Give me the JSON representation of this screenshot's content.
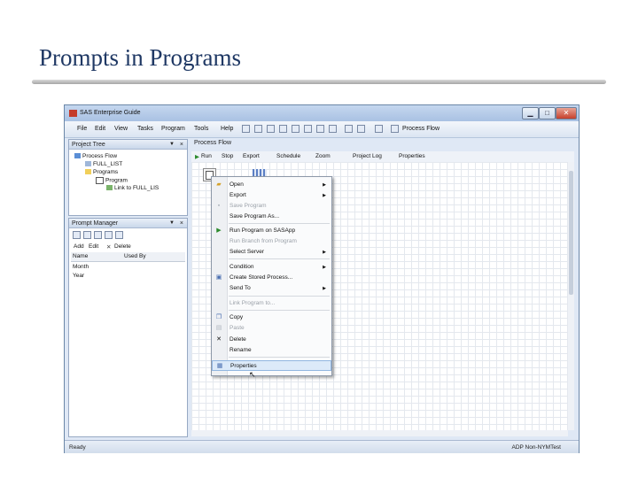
{
  "slide": {
    "title": "Prompts in Programs"
  },
  "window": {
    "title": "SAS Enterprise Guide",
    "controls": {
      "minimize": "▁",
      "maximize": "□",
      "close": "✕"
    }
  },
  "menubar": {
    "items": [
      "File",
      "Edit",
      "View",
      "Tasks",
      "Program",
      "Tools",
      "Help"
    ],
    "process_flow_label": "Process Flow"
  },
  "project_tree": {
    "title": "Project Tree",
    "nodes": [
      "Process Flow",
      "FULL_LIST",
      "Programs",
      "Program",
      "Link to FULL_LIS"
    ]
  },
  "prompt_manager": {
    "title": "Prompt Manager",
    "actions": {
      "add": "Add",
      "edit": "Edit",
      "delete": "Delete"
    },
    "columns": [
      "Name",
      "Used By"
    ],
    "rows": [
      "Month",
      "Year"
    ]
  },
  "workspace": {
    "tab_label": "Process Flow",
    "toolbar": [
      "Run",
      "Stop",
      "Export",
      "Schedule",
      "Zoom",
      "Project Log",
      "Properties"
    ]
  },
  "context_menu": {
    "items": [
      {
        "label": "Open",
        "submenu": true,
        "disabled": false
      },
      {
        "label": "Export",
        "submenu": true,
        "disabled": false
      },
      {
        "label": "Save Program",
        "submenu": false,
        "disabled": true
      },
      {
        "label": "Save Program As...",
        "submenu": false,
        "disabled": false
      },
      {
        "label": "Run Program on SASApp",
        "submenu": false,
        "disabled": false
      },
      {
        "label": "Run Branch from Program",
        "submenu": false,
        "disabled": true
      },
      {
        "label": "Select Server",
        "submenu": true,
        "disabled": false
      },
      {
        "label": "Condition",
        "submenu": true,
        "disabled": false
      },
      {
        "label": "Create Stored Process...",
        "submenu": false,
        "disabled": false
      },
      {
        "label": "Send To",
        "submenu": true,
        "disabled": false
      },
      {
        "label": "Link Program to...",
        "submenu": false,
        "disabled": true
      },
      {
        "label": "Copy",
        "submenu": false,
        "disabled": false
      },
      {
        "label": "Paste",
        "submenu": false,
        "disabled": true
      },
      {
        "label": "Delete",
        "submenu": false,
        "disabled": false
      },
      {
        "label": "Rename",
        "submenu": false,
        "disabled": false
      },
      {
        "label": "Properties",
        "submenu": false,
        "disabled": false
      }
    ]
  },
  "status": {
    "left": "Ready",
    "right": "ADP Non-NYMTest"
  },
  "colors": {
    "title": "#1f3864",
    "highlight": "#dceaf9"
  }
}
